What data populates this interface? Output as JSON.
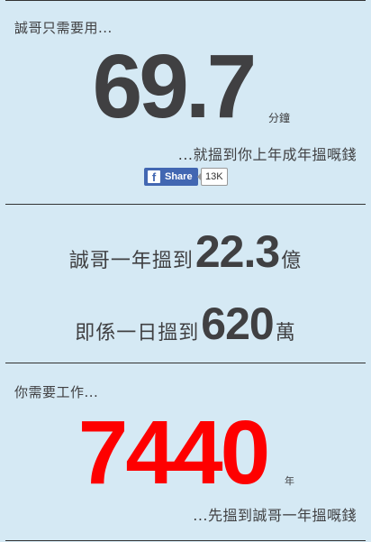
{
  "section1": {
    "intro": "誠哥只需要用...",
    "minutes": "69.7",
    "minutes_unit": "分鐘",
    "earn_text": "...就搵到你上年成年搵嘅錢"
  },
  "share": {
    "logo": "f",
    "label": "Share",
    "count": "13K",
    "brand_color": "#4267b2"
  },
  "section2": {
    "year_label": "誠哥一年搵到",
    "year_value": "22.3",
    "year_unit": "億",
    "day_label": "即係一日搵到",
    "day_value": "620",
    "day_unit": "萬"
  },
  "section3": {
    "intro": "你需要工作...",
    "years": "7440",
    "years_unit": "年",
    "earn_text": "...先搵到誠哥一年搵嘅錢",
    "highlight_color": "#fe0000"
  }
}
